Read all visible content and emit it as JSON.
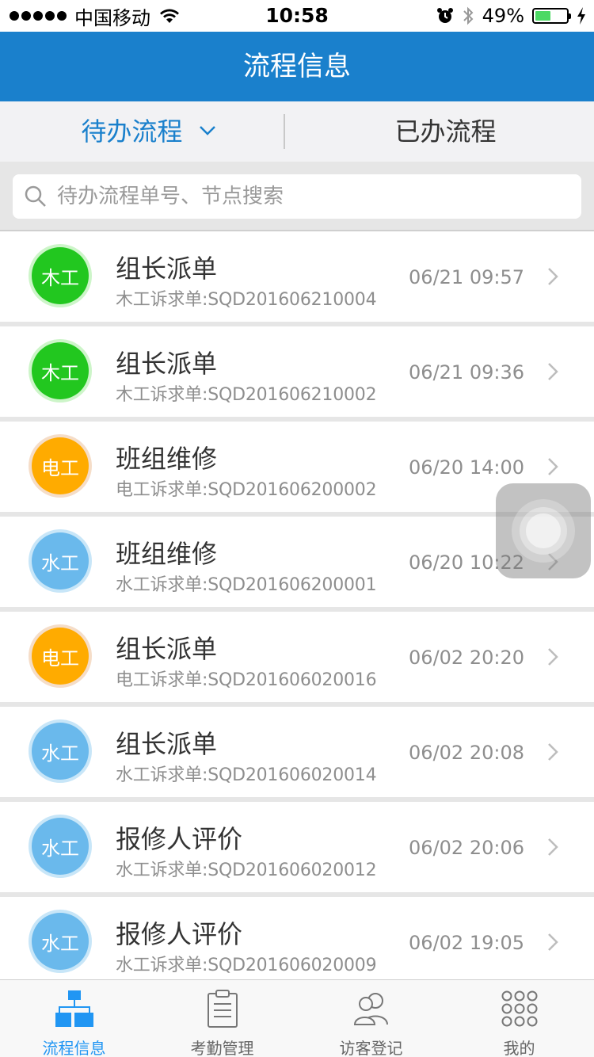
{
  "status_bar": {
    "carrier": "中国移动",
    "time": "10:58",
    "battery": "49%",
    "battery_level": 0.49
  },
  "nav": {
    "title": "流程信息"
  },
  "tabs": {
    "pending": "待办流程",
    "done": "已办流程"
  },
  "search": {
    "placeholder": "待办流程单号、节点搜索",
    "value": ""
  },
  "colors": {
    "brand": "#1a80cc",
    "green": "#22c71f",
    "orange": "#ffab00",
    "blue": "#6ab9ec"
  },
  "items": [
    {
      "badge": "木工",
      "badge_color": "green",
      "title": "组长派单",
      "subtitle": "木工诉求单:SQD201606210004",
      "time": "06/21 09:57"
    },
    {
      "badge": "木工",
      "badge_color": "green",
      "title": "组长派单",
      "subtitle": "木工诉求单:SQD201606210002",
      "time": "06/21 09:36"
    },
    {
      "badge": "电工",
      "badge_color": "orange",
      "title": "班组维修",
      "subtitle": "电工诉求单:SQD201606200002",
      "time": "06/20 14:00"
    },
    {
      "badge": "水工",
      "badge_color": "blue",
      "title": "班组维修",
      "subtitle": "水工诉求单:SQD201606200001",
      "time": "06/20 10:22"
    },
    {
      "badge": "电工",
      "badge_color": "orange",
      "title": "组长派单",
      "subtitle": "电工诉求单:SQD201606020016",
      "time": "06/02 20:20"
    },
    {
      "badge": "水工",
      "badge_color": "blue",
      "title": "组长派单",
      "subtitle": "水工诉求单:SQD201606020014",
      "time": "06/02 20:08"
    },
    {
      "badge": "水工",
      "badge_color": "blue",
      "title": "报修人评价",
      "subtitle": "水工诉求单:SQD201606020012",
      "time": "06/02 20:06"
    },
    {
      "badge": "水工",
      "badge_color": "blue",
      "title": "报修人评价",
      "subtitle": "水工诉求单:SQD201606020009",
      "time": "06/02 19:05"
    }
  ],
  "tabbar": {
    "items": [
      {
        "label": "流程信息",
        "icon": "hierarchy-icon",
        "active": true
      },
      {
        "label": "考勤管理",
        "icon": "clipboard-icon",
        "active": false
      },
      {
        "label": "访客登记",
        "icon": "people-icon",
        "active": false
      },
      {
        "label": "我的",
        "icon": "grid-dots-icon",
        "active": false
      }
    ]
  }
}
